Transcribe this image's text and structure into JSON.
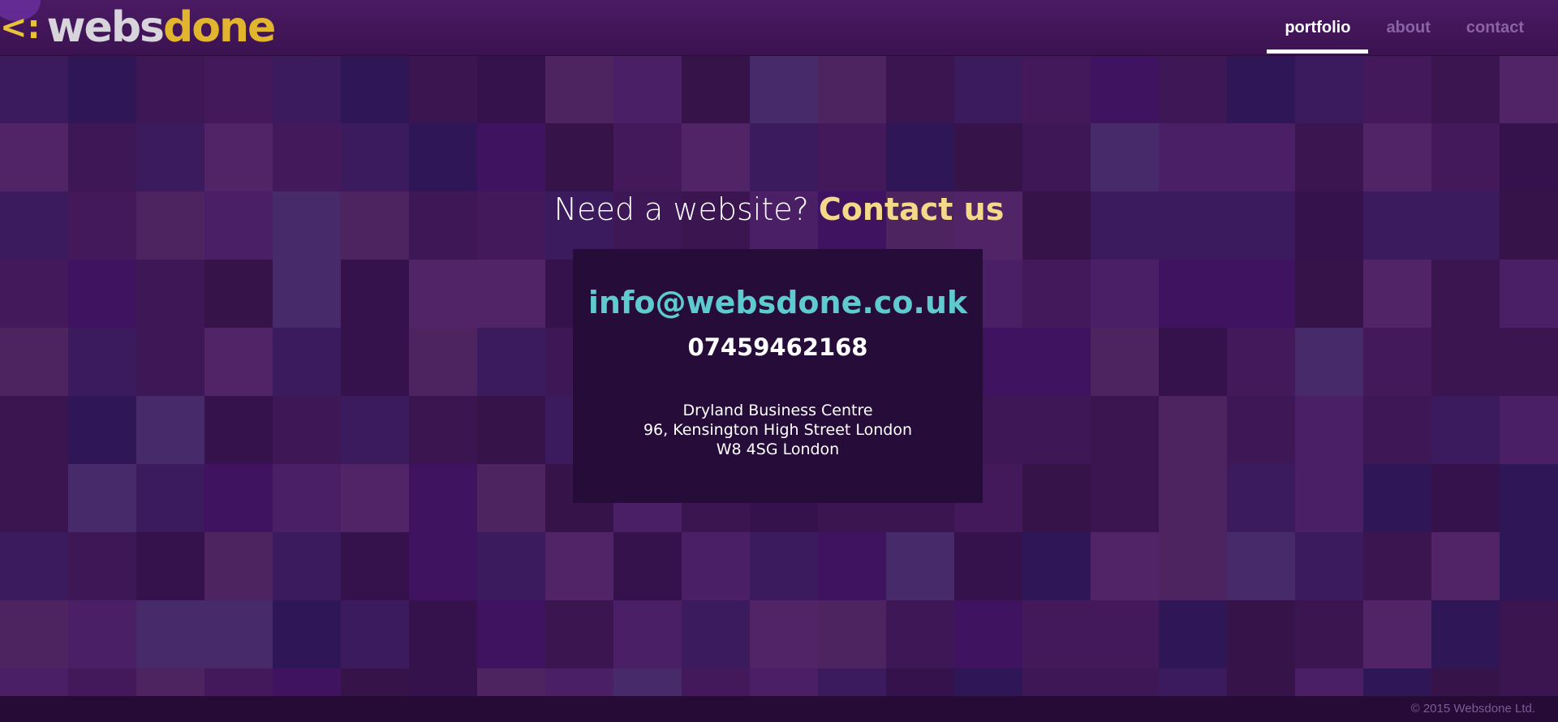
{
  "header": {
    "logo": {
      "text_part1": "webs",
      "text_part2": "done",
      "mark": "<:"
    },
    "nav": [
      {
        "label": "portfolio",
        "active": true
      },
      {
        "label": "about",
        "active": false
      },
      {
        "label": "contact",
        "active": false
      }
    ]
  },
  "main": {
    "headline_normal": "Need a website?",
    "headline_accent": "Contact us",
    "email": "info@websdone.co.uk",
    "phone": "07459462168",
    "address": [
      "Dryland Business Centre",
      "96, Kensington High Street London",
      "W8 4SG London"
    ]
  },
  "footer": {
    "copyright": "© 2015 Websdone Ltd."
  },
  "colors": {
    "background": "#3a1550",
    "accent_yellow": "#f5d98a",
    "email_teal": "#5ecbd0",
    "card_bg": "#260d39",
    "nav_inactive": "#8a63a6"
  }
}
